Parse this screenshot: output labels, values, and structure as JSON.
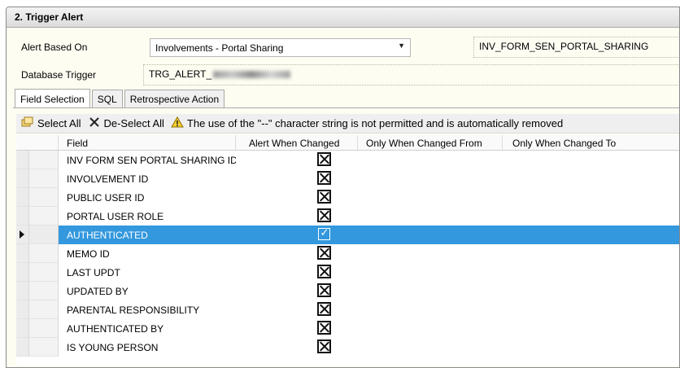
{
  "panel": {
    "title": "2. Trigger Alert"
  },
  "form": {
    "alert_based_on_label": "Alert Based On",
    "alert_based_on_value": "Involvements - Portal Sharing",
    "alert_based_on_code": "INV_FORM_SEN_PORTAL_SHARING",
    "database_trigger_label": "Database Trigger",
    "database_trigger_value": "TRG_ALERT_"
  },
  "tabs": [
    {
      "label": "Field Selection",
      "active": true
    },
    {
      "label": "SQL",
      "active": false
    },
    {
      "label": "Retrospective Action",
      "active": false
    }
  ],
  "toolbar": {
    "select_all": "Select All",
    "deselect_all": "De-Select All",
    "warning": "The use of the \"--\" character string is not permitted and is automatically removed"
  },
  "grid": {
    "columns": [
      "Field",
      "Alert When Changed",
      "Only When Changed From",
      "Only When Changed To"
    ],
    "rows": [
      {
        "field": "INV FORM SEN PORTAL SHARING ID",
        "checked": false,
        "selected": false
      },
      {
        "field": "INVOLVEMENT ID",
        "checked": false,
        "selected": false
      },
      {
        "field": "PUBLIC USER ID",
        "checked": false,
        "selected": false
      },
      {
        "field": "PORTAL USER ROLE",
        "checked": false,
        "selected": false
      },
      {
        "field": "AUTHENTICATED",
        "checked": true,
        "selected": true
      },
      {
        "field": "MEMO ID",
        "checked": false,
        "selected": false
      },
      {
        "field": "LAST UPDT",
        "checked": false,
        "selected": false
      },
      {
        "field": "UPDATED BY",
        "checked": false,
        "selected": false
      },
      {
        "field": "PARENTAL RESPONSIBILITY",
        "checked": false,
        "selected": false
      },
      {
        "field": "AUTHENTICATED BY",
        "checked": false,
        "selected": false
      },
      {
        "field": "IS YOUNG PERSON",
        "checked": false,
        "selected": false
      }
    ]
  },
  "colors": {
    "selection": "#3398dd",
    "panel_bg": "#fdfdf2"
  }
}
